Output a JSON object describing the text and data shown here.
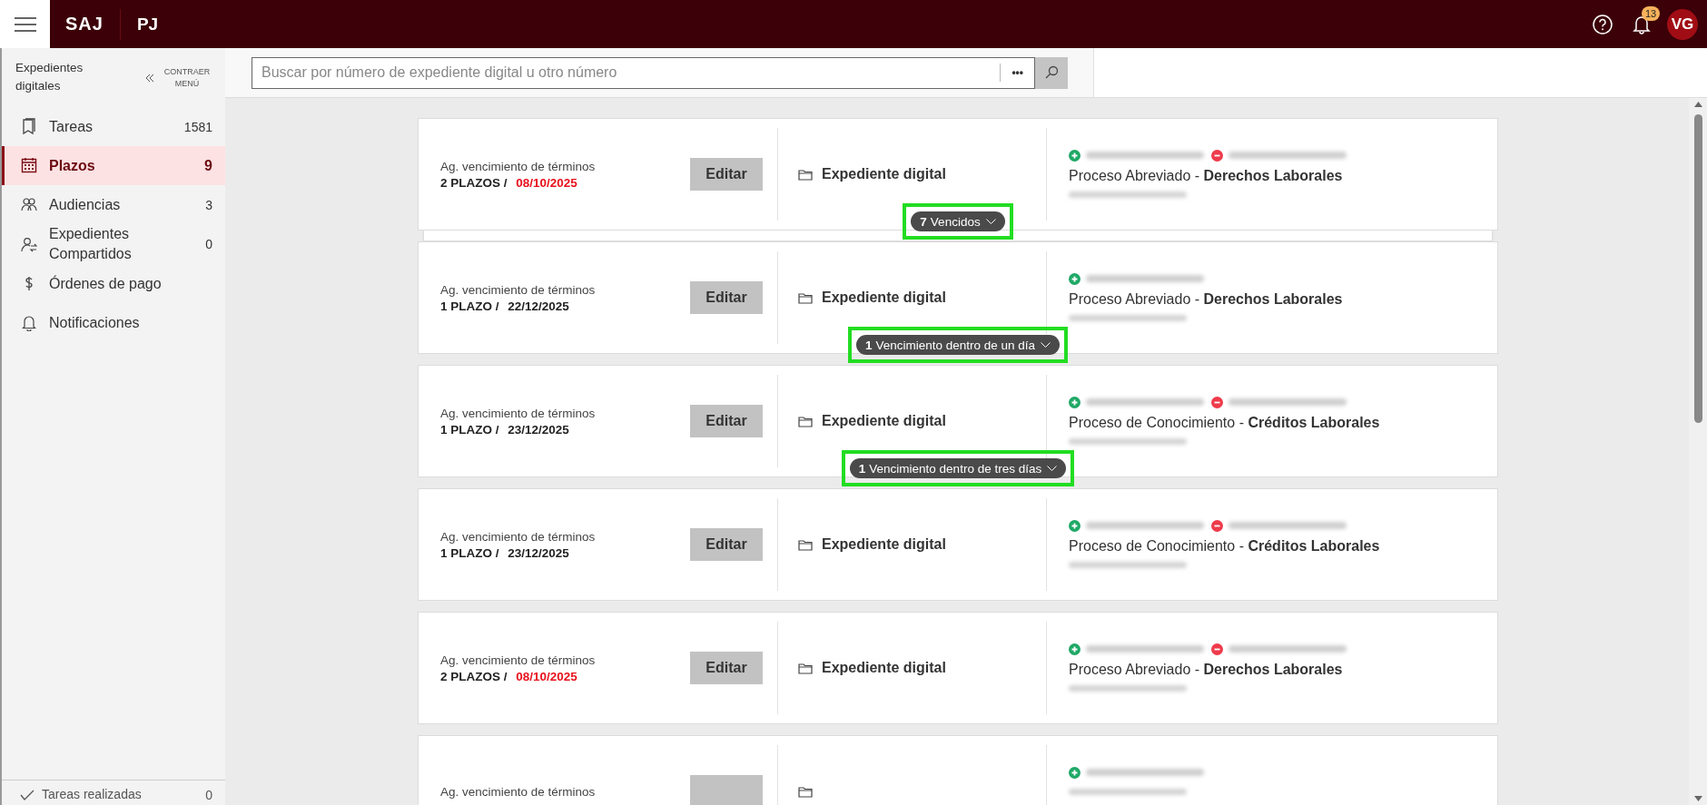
{
  "topbar": {
    "logo": "SAJ",
    "sublogo": "PJ",
    "notifications": "13",
    "avatar": "VG"
  },
  "sidebar": {
    "title": "Expedientes digitales",
    "collapse": "CONTRAER MENÚ",
    "items": [
      {
        "kind": "bookmark",
        "label": "Tareas",
        "count": "1581",
        "selected": false
      },
      {
        "kind": "calendar",
        "label": "Plazos",
        "count": "9",
        "selected": true
      },
      {
        "kind": "people",
        "label": "Audiencias",
        "count": "3",
        "selected": false
      },
      {
        "kind": "share",
        "label": "Expedientes Compartidos",
        "count": "0",
        "selected": false
      },
      {
        "kind": "dollar",
        "label": "Órdenes de pago",
        "selected": false
      },
      {
        "kind": "bell",
        "label": "Notificaciones",
        "selected": false
      }
    ],
    "footer": {
      "label": "Tareas realizadas",
      "count": "0"
    }
  },
  "search": {
    "placeholder": "Buscar por número de expediente digital u otro número",
    "more": "•••"
  },
  "cards": [
    {
      "label": "Ag. vencimiento de términos",
      "plazos": "2 PLAZOS",
      "sep": "/",
      "date": "08/10/2025",
      "overdue": true,
      "button": "Editar",
      "link": "Expediente digital",
      "parties": [
        {
          "kind": "plus"
        },
        {
          "kind": "minus"
        }
      ],
      "process": "Proceso Abreviado - **Derechos Laborales**",
      "stacked": true,
      "badge": {
        "count": "7",
        "text": "Vencidos",
        "highlighted": true
      }
    },
    {
      "label": "Ag. vencimiento de términos",
      "plazos": "1 PLAZO",
      "sep": "/",
      "date": "22/12/2025",
      "overdue": false,
      "button": "Editar",
      "link": "Expediente digital",
      "parties": [
        {
          "kind": "plus"
        }
      ],
      "process": "Proceso Abreviado - **Derechos Laborales**",
      "stacked": false,
      "badge": {
        "count": "1",
        "text": "Vencimiento dentro de un día",
        "highlighted": true
      }
    },
    {
      "label": "Ag. vencimiento de términos",
      "plazos": "1 PLAZO",
      "sep": "/",
      "date": "23/12/2025",
      "overdue": false,
      "button": "Editar",
      "link": "Expediente digital",
      "parties": [
        {
          "kind": "plus"
        },
        {
          "kind": "minus"
        }
      ],
      "process": "Proceso de Conocimiento - **Créditos Laborales**",
      "stacked": false,
      "badge": {
        "count": "1",
        "text": "Vencimiento dentro de tres días",
        "highlighted": true
      }
    },
    {
      "label": "Ag. vencimiento de términos",
      "plazos": "1 PLAZO",
      "sep": "/",
      "date": "23/12/2025",
      "overdue": false,
      "button": "Editar",
      "link": "Expediente digital",
      "parties": [
        {
          "kind": "plus"
        },
        {
          "kind": "minus"
        }
      ],
      "process": "Proceso de Conocimiento - **Créditos Laborales**",
      "stacked": false
    },
    {
      "label": "Ag. vencimiento de términos",
      "plazos": "2 PLAZOS",
      "sep": "/",
      "date": "08/10/2025",
      "overdue": true,
      "button": "Editar",
      "link": "Expediente digital",
      "parties": [
        {
          "kind": "plus"
        },
        {
          "kind": "minus"
        }
      ],
      "process": "Proceso Abreviado - **Derechos Laborales**",
      "stacked": false
    },
    {
      "label": "Ag. vencimiento de términos",
      "parties": [
        {
          "kind": "plus"
        }
      ],
      "stacked": false
    }
  ]
}
